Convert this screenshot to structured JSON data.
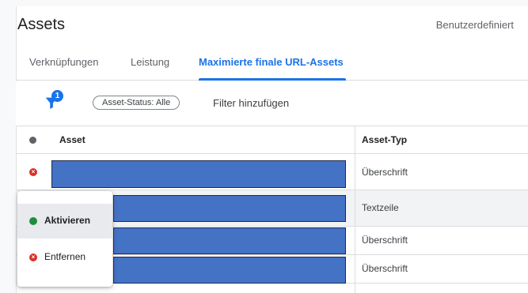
{
  "header": {
    "title": "Assets",
    "custom_label": "Benutzerdefiniert"
  },
  "tabs": [
    {
      "label": "Verknüpfungen"
    },
    {
      "label": "Leistung"
    },
    {
      "label": "Maximierte finale URL-Assets",
      "active": true
    }
  ],
  "filter": {
    "badge_count": "1",
    "chip_label": "Asset-Status: Alle",
    "add_filter_label": "Filter hinzufügen"
  },
  "table": {
    "columns": [
      "Asset",
      "Asset-Typ"
    ],
    "rows": [
      {
        "status": "removed",
        "asset_redacted": true,
        "type": "Überschrift"
      },
      {
        "status": "",
        "asset_redacted": true,
        "type": "Textzeile"
      },
      {
        "status": "",
        "asset_redacted": true,
        "type": "Überschrift"
      },
      {
        "status": "",
        "asset_redacted": true,
        "type": "Überschrift"
      }
    ]
  },
  "status_menu": {
    "items": [
      {
        "label": "Aktivieren",
        "icon": "green-dot-icon",
        "highlighted": true
      },
      {
        "label": "Entfernen",
        "icon": "red-x-icon"
      }
    ]
  },
  "colors": {
    "accent": "#1a73e8",
    "removed": "#d93025",
    "enabled": "#1e8e3e",
    "redaction": "#4472c4"
  }
}
